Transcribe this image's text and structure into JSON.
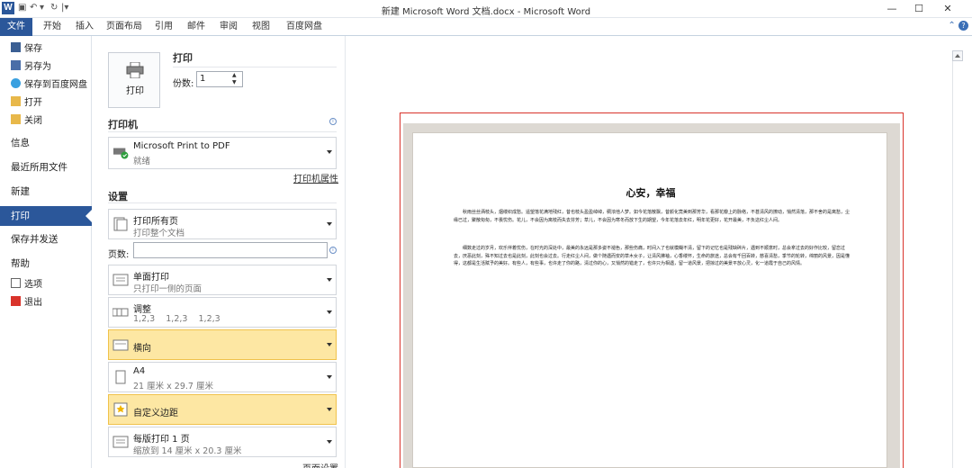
{
  "window": {
    "title": "新建 Microsoft Word 文档.docx - Microsoft Word",
    "app_icon": "W",
    "minimize": "—",
    "maximize": "☐",
    "close": "✕"
  },
  "ribbon": {
    "tabs": [
      "文件",
      "开始",
      "插入",
      "页面布局",
      "引用",
      "邮件",
      "审阅",
      "视图",
      "百度网盘"
    ]
  },
  "nav": {
    "items": [
      {
        "label": "保存",
        "icon": "save-icon"
      },
      {
        "label": "另存为",
        "icon": "save-as-icon"
      },
      {
        "label": "保存到百度网盘",
        "icon": "baidu-cloud-icon"
      },
      {
        "label": "打开",
        "icon": "open-folder-icon"
      },
      {
        "label": "关闭",
        "icon": "close-folder-icon"
      },
      {
        "label": "信息"
      },
      {
        "label": "最近所用文件"
      },
      {
        "label": "新建"
      },
      {
        "label": "打印"
      },
      {
        "label": "保存并发送"
      },
      {
        "label": "帮助"
      },
      {
        "label": "选项",
        "icon": "options-icon"
      },
      {
        "label": "退出",
        "icon": "exit-icon"
      }
    ]
  },
  "print": {
    "section_title": "打印",
    "button_label": "打印",
    "copies_label": "份数:",
    "copies_value": "1"
  },
  "printer": {
    "section_title": "打印机",
    "name": "Microsoft Print to PDF",
    "status": "就绪",
    "properties_link": "打印机属性"
  },
  "settings": {
    "section_title": "设置",
    "range": {
      "title": "打印所有页",
      "sub": "打印整个文档"
    },
    "pages_label": "页数:",
    "sided": {
      "title": "单面打印",
      "sub": "只打印一侧的页面"
    },
    "collate": {
      "title": "调整",
      "sub": "1,2,3    1,2,3    1,2,3"
    },
    "orientation": {
      "title": "横向"
    },
    "paper": {
      "title": "A4",
      "sub": "21 厘米 x 29.7 厘米"
    },
    "margins": {
      "title": "自定义边距"
    },
    "per_sheet": {
      "title": "每版打印 1 页",
      "sub": "缩放到 14 厘米 x 20.3 厘米"
    },
    "page_setup_link": "页面设置"
  },
  "document": {
    "title": "心安，幸福",
    "para1": "秋雨丝丝洒枝头，烟缕织成愁。遥望落花满地残红，昔也枝头盈盈绰绰，稠浓他人梦。如今花落散飘，昔颜化竟美到那芳华，看那花瓣上的脉络，不甚清风的撩动，悄然清落，那不舍的是离愁，尘缘已过，聚散匆匆，不畏忧伤。花儿，不会因为离枝而失去芬芳；草儿，不会因为寒冬而放下生的期望，今年花落去年红，明年花更好，花开最美，不负这红尘人间。",
    "para2": "细数走过的岁月，欢乐伴着忧伤，在时光的深处中，最美的永远是那多姿不褪色，那些伤痛，时间入了也就模糊不清，留下的记忆也是残缺碎片，遇到不顺意时，总会拿过去的好作比较，留恋过去，厌恶此刻，殊不知过去也是此刻，此刻也会过去。行走红尘人间，做个随遇而安的草木女子，让清风拂袖，心香缕怀，生命的旅途，总会有千回百转，慈喜清愁，季节的轮转，绵丽的风景，因是懂得，这都是生活赋予的美好。有些人，有些事，也许走了你的路，清过你的心，又悄然的错走了，也许只为相遇，留一道风景，把掠过的美景平放心灵，化一道霞于自己的风情。"
  }
}
